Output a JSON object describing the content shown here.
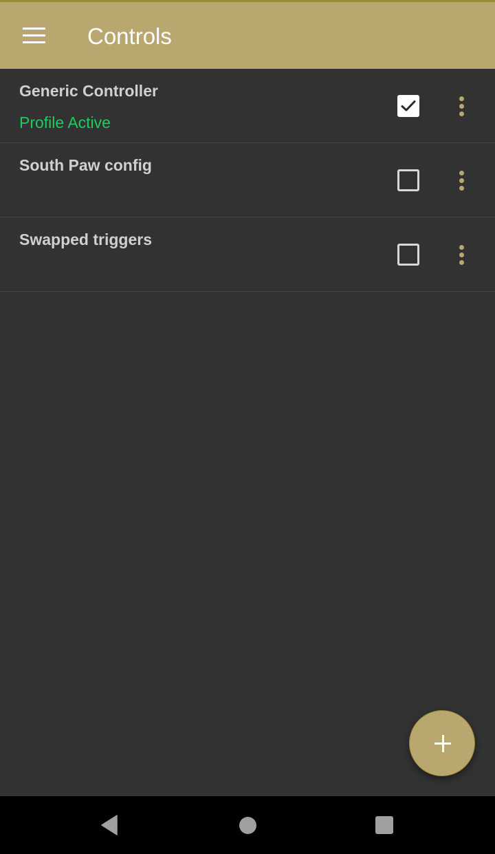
{
  "appbar": {
    "title": "Controls",
    "menu_icon": "hamburger-menu-icon"
  },
  "profiles": [
    {
      "name": "Generic Controller",
      "status": "Profile Active",
      "checked": true
    },
    {
      "name": "South Paw config",
      "status": "",
      "checked": false
    },
    {
      "name": "Swapped triggers",
      "status": "",
      "checked": false
    }
  ],
  "fab": {
    "icon": "plus-icon",
    "action": "add-profile"
  },
  "navigation_bar": {
    "back_icon": "back-triangle-icon",
    "home_icon": "home-circle-icon",
    "recents_icon": "recents-square-icon"
  },
  "colors": {
    "accent": "#B9A770",
    "accent_dark": "#9C8A35",
    "background": "#323232",
    "active_status": "#1ECB5F",
    "item_text": "#D0D0D0",
    "divider": "#474747"
  }
}
